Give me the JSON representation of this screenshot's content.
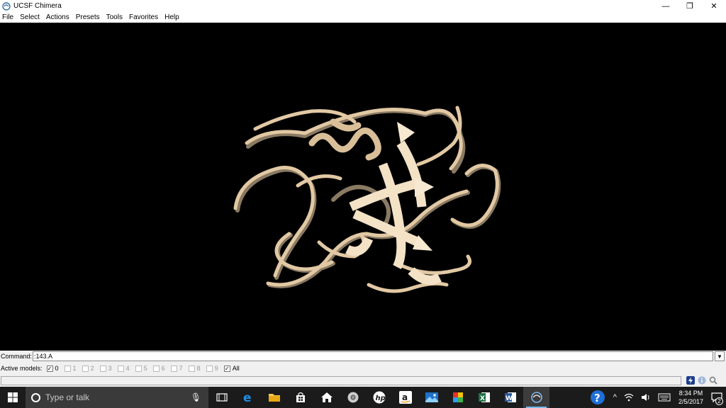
{
  "window": {
    "title": "UCSF Chimera",
    "controls": {
      "minimize": "—",
      "restore": "❐",
      "close": "✕"
    }
  },
  "menubar": {
    "items": [
      "File",
      "Select",
      "Actions",
      "Presets",
      "Tools",
      "Favorites",
      "Help"
    ]
  },
  "viewport": {
    "background": "#000000",
    "ribbon_color": "#e8d2b0"
  },
  "command": {
    "label": "Command:",
    "value": ":143.A"
  },
  "active_models": {
    "label": "Active models:",
    "models": [
      {
        "label": "0",
        "checked": true,
        "enabled": true
      },
      {
        "label": "1",
        "checked": false,
        "enabled": false
      },
      {
        "label": "2",
        "checked": false,
        "enabled": false
      },
      {
        "label": "3",
        "checked": false,
        "enabled": false
      },
      {
        "label": "4",
        "checked": false,
        "enabled": false
      },
      {
        "label": "5",
        "checked": false,
        "enabled": false
      },
      {
        "label": "6",
        "checked": false,
        "enabled": false
      },
      {
        "label": "7",
        "checked": false,
        "enabled": false
      },
      {
        "label": "8",
        "checked": false,
        "enabled": false
      },
      {
        "label": "9",
        "checked": false,
        "enabled": false
      },
      {
        "label": "All",
        "checked": true,
        "enabled": true
      }
    ]
  },
  "taskbar": {
    "search_placeholder": "Type or talk",
    "apps": [
      "task-view",
      "edge",
      "file-explorer",
      "store",
      "home",
      "chrome",
      "hp",
      "amazon",
      "photos",
      "paint",
      "excel",
      "word",
      "chimera"
    ],
    "clock_time": "8:34 PM",
    "clock_date": "2/5/2017",
    "notification_count": "2"
  }
}
